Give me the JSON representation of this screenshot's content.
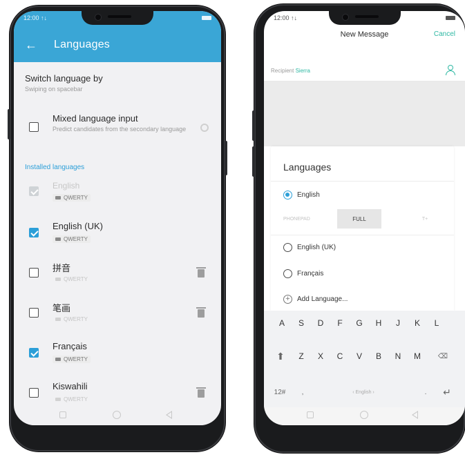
{
  "left_phone": {
    "status": {
      "time": "12:00 ↑↓"
    },
    "appbar": {
      "back_glyph": "←",
      "title": "Languages"
    },
    "switch_by": {
      "title": "Switch language by",
      "subtitle": "Swiping on spacebar"
    },
    "mixed": {
      "title": "Mixed language input",
      "subtitle": "Predict candidates from the secondary language",
      "checked": false
    },
    "section_label": "Installed languages",
    "languages": [
      {
        "name": "English",
        "layout": "QWERTY",
        "checked": true,
        "disabled": true,
        "deletable": false
      },
      {
        "name": "English (UK)",
        "layout": "QWERTY",
        "checked": true,
        "disabled": false,
        "deletable": false
      },
      {
        "name": "拼音",
        "layout": "QWERTY",
        "checked": false,
        "disabled": false,
        "deletable": true
      },
      {
        "name": "笔画",
        "layout": "QWERTY",
        "checked": false,
        "disabled": false,
        "deletable": true
      },
      {
        "name": "Français",
        "layout": "QWERTY",
        "checked": true,
        "disabled": false,
        "deletable": false
      },
      {
        "name": "Kiswahili",
        "layout": "QWERTY",
        "checked": false,
        "disabled": false,
        "deletable": true
      }
    ],
    "colors": {
      "accent": "#3aa6d6",
      "check": "#2c9fd8"
    }
  },
  "right_phone": {
    "status": {
      "time": "12:00 ↑↓"
    },
    "header": {
      "title": "New Message",
      "cancel": "Cancel"
    },
    "recipient": {
      "label": "Recipient",
      "name": "Sierra"
    },
    "sheet": {
      "title": "Languages",
      "selected": "English",
      "modes": [
        "PHONEPAD",
        "FULL",
        "T+"
      ],
      "active_mode": "FULL",
      "others": [
        "English (UK)",
        "Français"
      ],
      "add": "Add Language..."
    },
    "keyboard": {
      "row1": [
        "A",
        "S",
        "D",
        "F",
        "G",
        "H",
        "J",
        "K",
        "L"
      ],
      "row2": [
        "Z",
        "X",
        "C",
        "V",
        "B",
        "N",
        "M"
      ],
      "num_key": "12#",
      "space_label": "‹ English ›",
      "comma": ",",
      "period": "."
    },
    "colors": {
      "accent": "#2eb8a3",
      "radio": "#2c9fd8"
    }
  }
}
